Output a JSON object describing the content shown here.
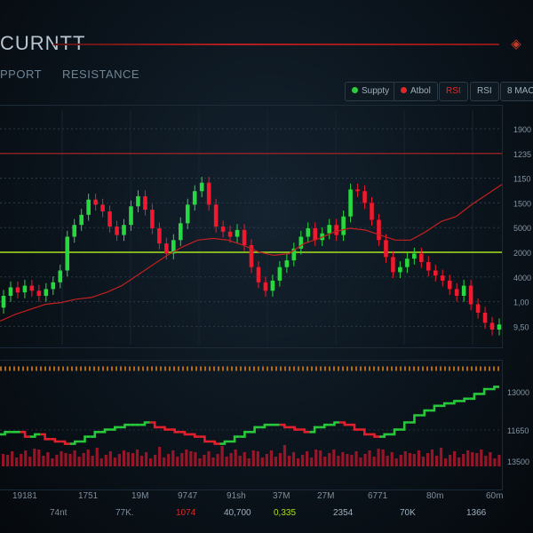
{
  "header": {
    "title": "CURNTT",
    "tabs": [
      "PPORT",
      "RESISTANCE"
    ],
    "chips": [
      {
        "label": "Suppty",
        "dot": "#2ecc40"
      },
      {
        "label": "Atbol",
        "dot": "#e0282a"
      },
      {
        "label": "RSI"
      },
      {
        "label": "RSI"
      },
      {
        "label": "8 MACD"
      }
    ]
  },
  "chart_data": [
    {
      "type": "candlestick",
      "y_tick_labels": [
        "1900",
        "1235",
        "1150",
        "1500",
        "5000",
        "2000",
        "4000",
        "1,00",
        "9,50"
      ],
      "lines": {
        "resistance": {
          "color": "#b22424",
          "tick": "1235"
        },
        "support": {
          "color": "#a8e21e",
          "tick": "2000"
        }
      },
      "candles": [
        [
          2.3,
          3.0
        ],
        [
          3.0,
          3.5
        ],
        [
          3.5,
          3.2
        ],
        [
          3.2,
          3.6
        ],
        [
          3.6,
          3.3
        ],
        [
          3.3,
          3.0
        ],
        [
          3.0,
          3.4
        ],
        [
          3.4,
          3.8
        ],
        [
          3.8,
          4.5
        ],
        [
          4.5,
          6.5
        ],
        [
          6.5,
          7.2
        ],
        [
          7.2,
          7.8
        ],
        [
          7.8,
          8.7
        ],
        [
          8.7,
          8.4
        ],
        [
          8.4,
          8.0
        ],
        [
          8.0,
          7.1
        ],
        [
          7.1,
          6.6
        ],
        [
          6.6,
          7.2
        ],
        [
          7.2,
          8.3
        ],
        [
          8.3,
          8.9
        ],
        [
          8.9,
          8.1
        ],
        [
          8.1,
          7.0
        ],
        [
          7.0,
          6.1
        ],
        [
          6.1,
          5.5
        ],
        [
          5.5,
          6.3
        ],
        [
          6.3,
          7.3
        ],
        [
          7.3,
          8.4
        ],
        [
          8.4,
          9.2
        ],
        [
          9.2,
          9.7
        ],
        [
          9.7,
          8.4
        ],
        [
          8.4,
          7.1
        ],
        [
          7.1,
          6.8
        ],
        [
          6.8,
          6.5
        ],
        [
          6.5,
          6.9
        ],
        [
          6.9,
          6.0
        ],
        [
          6.0,
          4.7
        ],
        [
          4.7,
          3.8
        ],
        [
          3.8,
          3.3
        ],
        [
          3.3,
          3.9
        ],
        [
          3.9,
          4.7
        ],
        [
          4.7,
          5.1
        ],
        [
          5.1,
          5.8
        ],
        [
          5.8,
          6.5
        ],
        [
          6.5,
          7.0
        ],
        [
          7.0,
          6.3
        ],
        [
          6.3,
          6.7
        ],
        [
          6.7,
          7.2
        ],
        [
          7.2,
          6.6
        ],
        [
          6.6,
          7.7
        ],
        [
          7.7,
          9.3
        ],
        [
          9.3,
          9.2
        ],
        [
          9.2,
          8.5
        ],
        [
          8.5,
          7.5
        ],
        [
          7.5,
          6.3
        ],
        [
          6.3,
          5.3
        ],
        [
          5.3,
          4.4
        ],
        [
          4.4,
          4.7
        ],
        [
          4.7,
          5.2
        ],
        [
          5.2,
          5.5
        ],
        [
          5.5,
          5.0
        ],
        [
          5.0,
          4.5
        ],
        [
          4.5,
          4.2
        ],
        [
          4.2,
          3.9
        ],
        [
          3.9,
          3.4
        ],
        [
          3.4,
          3.0
        ],
        [
          3.0,
          3.6
        ],
        [
          3.6,
          2.5
        ],
        [
          2.5,
          2.0
        ],
        [
          2.0,
          1.4
        ],
        [
          1.4,
          1.0
        ],
        [
          1.0,
          1.3
        ]
      ],
      "moving_average": [
        1.5,
        1.9,
        2.2,
        2.5,
        2.6,
        2.8,
        2.9,
        3.2,
        3.6,
        4.2,
        4.8,
        5.4,
        5.9,
        6.3,
        6.4,
        6.3,
        6.0,
        5.6,
        5.4,
        5.5,
        6.1,
        6.4,
        6.8,
        7.0,
        6.9,
        6.6,
        6.3,
        6.3,
        6.8,
        7.4,
        7.7,
        8.4,
        9.0,
        9.6
      ]
    },
    {
      "type": "line",
      "y_tick_labels": [
        "13000",
        "11650",
        "13500"
      ],
      "values": [
        0.6,
        0.7,
        0.7,
        0.5,
        0.6,
        0.4,
        0.3,
        0.2,
        0.3,
        0.5,
        0.7,
        0.8,
        0.9,
        1.0,
        1.0,
        1.1,
        0.9,
        0.8,
        0.7,
        0.6,
        0.5,
        0.3,
        0.2,
        0.3,
        0.5,
        0.7,
        0.9,
        1.0,
        1.0,
        0.9,
        0.8,
        0.7,
        0.9,
        1.0,
        1.1,
        1.0,
        0.8,
        0.6,
        0.5,
        0.6,
        0.8,
        1.1,
        1.4,
        1.6,
        1.8,
        1.9,
        2.0,
        2.1,
        2.3,
        2.5,
        2.6
      ]
    }
  ],
  "x_labels_row1": [
    "19181",
    "1751",
    "19M",
    "9747",
    "91sh",
    "37M",
    "27M",
    "6771",
    "80m",
    "60m"
  ],
  "x_labels_row2": [
    "74nt",
    "77K.",
    "1074",
    "40,700",
    "0,335",
    "2354",
    "70K",
    "1366"
  ],
  "x_labels_row2_colors": [
    "#7e8e9c",
    "#7e8e9c",
    "#e0282a",
    "#9fb0bd",
    "#a8e21e",
    "#9fb0bd",
    "#9fb0bd",
    "#9fb0bd"
  ]
}
